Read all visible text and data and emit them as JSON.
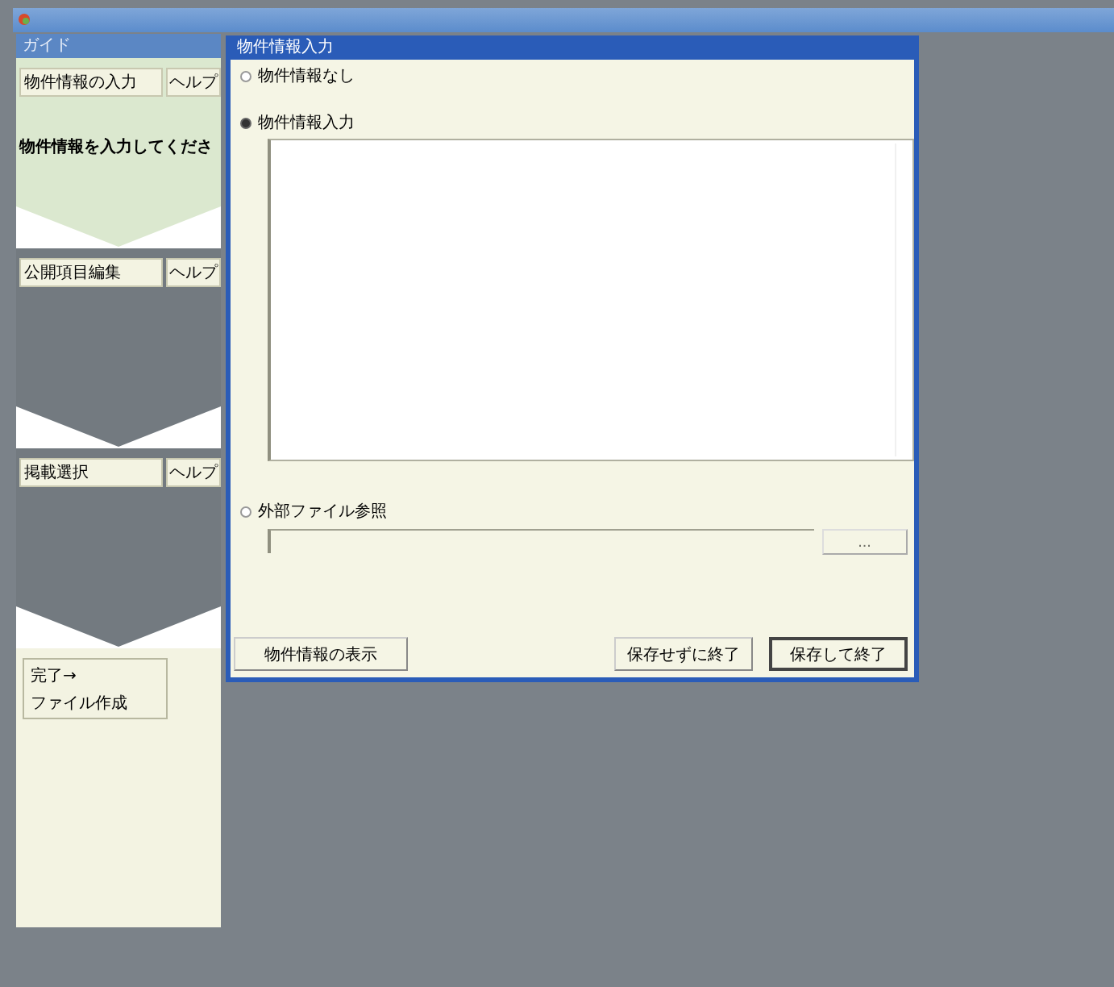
{
  "panel": {
    "title": "ガイド",
    "steps": [
      {
        "label": "物件情報の入力",
        "help": "ヘルプ",
        "active": true,
        "message": "物件情報を入力してくださ"
      },
      {
        "label": "公開項目編集",
        "help": "ヘルプ",
        "active": false
      },
      {
        "label": "掲載選択",
        "help": "ヘルプ",
        "active": false
      }
    ],
    "finish": {
      "line1": "完了→",
      "line2": "ファイル作成"
    }
  },
  "dialog": {
    "title": "物件情報入力",
    "options": [
      {
        "label": "物件情報なし",
        "selected": false,
        "kind": "none"
      },
      {
        "label": "物件情報入力",
        "selected": true,
        "kind": "text"
      },
      {
        "label": "外部ファイル参照",
        "selected": false,
        "kind": "file"
      }
    ],
    "browse": "...",
    "buttons": [
      {
        "label": "物件情報の表示",
        "default": false
      },
      {
        "label": "保存せずに終了",
        "default": false
      },
      {
        "label": "保存して終了",
        "default": true
      }
    ]
  }
}
